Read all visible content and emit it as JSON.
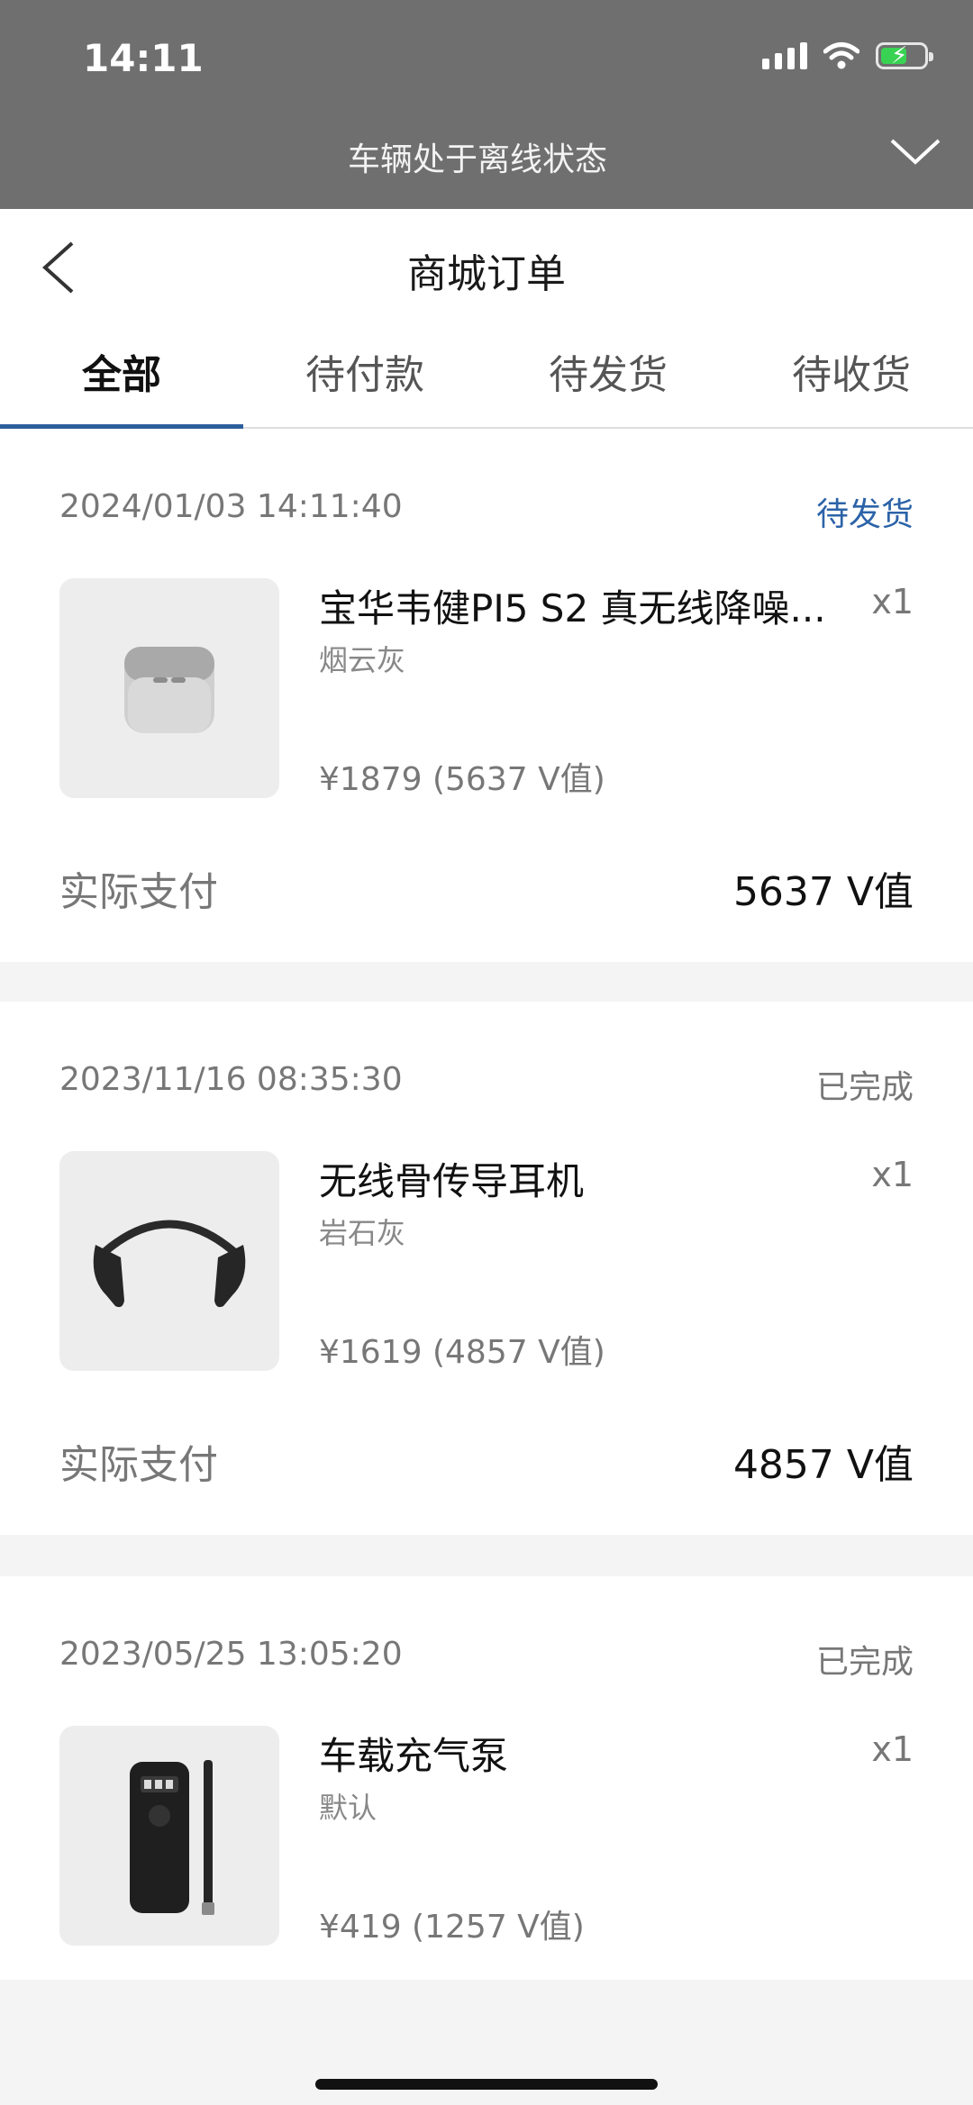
{
  "status_bar": {
    "time": "14:11",
    "offline_text": "车辆处于离线状态"
  },
  "header": {
    "title": "商城订单"
  },
  "tabs": [
    {
      "label": "全部",
      "active": true
    },
    {
      "label": "待付款",
      "active": false
    },
    {
      "label": "待发货",
      "active": false
    },
    {
      "label": "待收货",
      "active": false
    }
  ],
  "orders": [
    {
      "datetime": "2024/01/03 14:11:40",
      "status": "待发货",
      "product_name": "宝华韦健PI5 S2 真无线降噪...",
      "quantity": "x1",
      "variant": "烟云灰",
      "price": "¥1879 (5637 V值)",
      "paid_label": "实际支付",
      "paid_value": "5637 V值"
    },
    {
      "datetime": "2023/11/16 08:35:30",
      "status": "已完成",
      "product_name": "无线骨传导耳机",
      "quantity": "x1",
      "variant": "岩石灰",
      "price": "¥1619 (4857 V值)",
      "paid_label": "实际支付",
      "paid_value": "4857 V值"
    },
    {
      "datetime": "2023/05/25 13:05:20",
      "status": "已完成",
      "product_name": "车载充气泵",
      "quantity": "x1",
      "variant": "默认",
      "price": "¥419 (1257 V值)"
    }
  ],
  "colors": {
    "accent": "#2e5f9c",
    "status_pending": "#2c63a8",
    "status_bar_bg": "#6f6f6f"
  }
}
